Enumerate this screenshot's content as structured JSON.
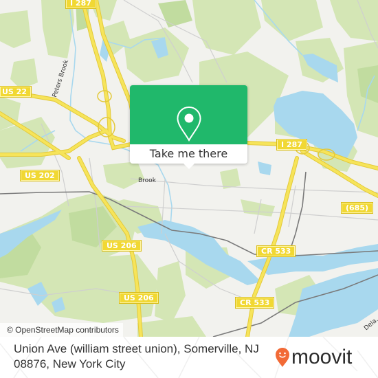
{
  "map": {
    "attribution": "© OpenStreetMap contributors",
    "colors": {
      "background": "#f2f2ee",
      "park": "#d4e6b5",
      "park_dark": "#c1dc9f",
      "water": "#a8d8ee",
      "highway": "#f6e45a",
      "highway_edge": "#e3c93a",
      "road": "#c8c8c8",
      "rail": "#707070"
    },
    "shields": [
      {
        "label": "I 287"
      },
      {
        "label": "US 22"
      },
      {
        "label": "US 202"
      },
      {
        "label": "I 287"
      },
      {
        "label": "(685)"
      },
      {
        "label": "US 206"
      },
      {
        "label": "CR 533"
      },
      {
        "label": "US 206"
      },
      {
        "label": "CR 533"
      }
    ],
    "labels": {
      "river1": "Peters Brook",
      "river2": "Brook",
      "river3": "Dela..."
    }
  },
  "popup": {
    "icon": "map-pin-icon",
    "button_label": "Take me there",
    "accent": "#20b86b"
  },
  "footer": {
    "address": "Union Ave (william street union), Somerville, NJ 08876, New York City",
    "logo": {
      "icon": "moovit-pin-icon",
      "text": "moovit",
      "color": "#f26a36"
    }
  }
}
